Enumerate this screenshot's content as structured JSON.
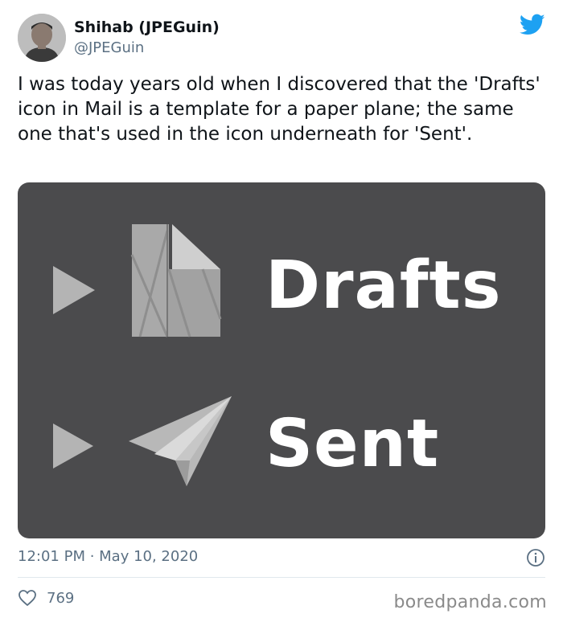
{
  "author": {
    "name": "Shihab (JPEGuin)",
    "handle": "@JPEGuin"
  },
  "tweet": {
    "text": "I was today years old when I discovered that the 'Drafts' icon in Mail is a template for a paper plane; the same one that's used in the icon underneath for 'Sent'."
  },
  "media": {
    "rows": [
      {
        "label": "Drafts",
        "icon": "drafts-folded-paper-icon"
      },
      {
        "label": "Sent",
        "icon": "paper-plane-icon"
      }
    ],
    "background": "#4b4b4d"
  },
  "meta": {
    "timestamp": "12:01 PM · May 10, 2020",
    "like_count": "769"
  },
  "watermark": "boredpanda.com",
  "colors": {
    "twitter_blue": "#1da1f2",
    "secondary_text": "#5b7083"
  }
}
